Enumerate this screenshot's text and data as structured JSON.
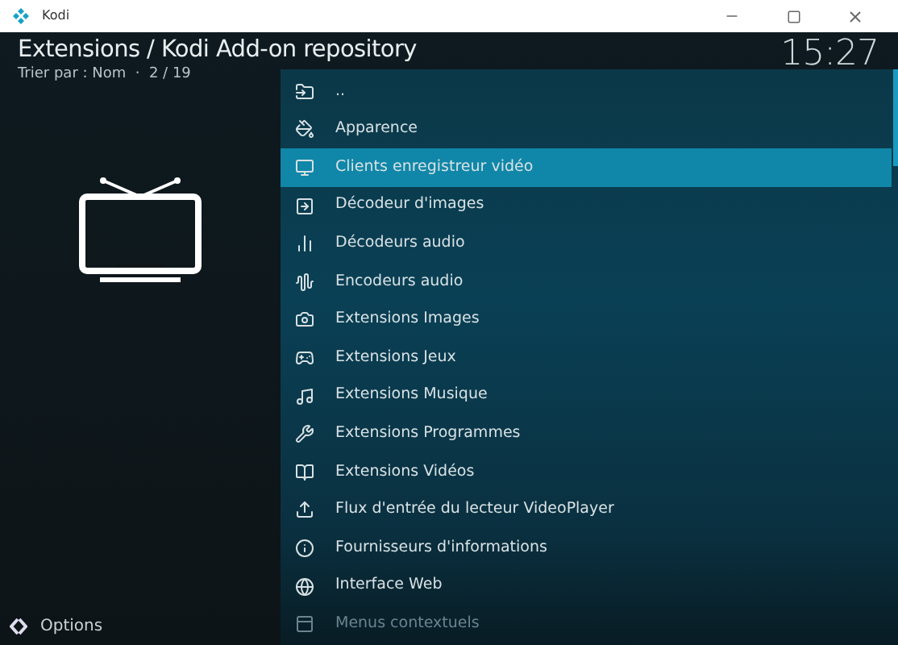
{
  "window": {
    "title": "Kodi"
  },
  "header": {
    "breadcrumb": "Extensions / Kodi Add-on repository",
    "sort_info": "Trier par : Nom  ·  2 / 19",
    "clock": "15:27"
  },
  "items": [
    {
      "label": "..",
      "selected": false,
      "dimmed": false
    },
    {
      "label": "Apparence",
      "selected": false,
      "dimmed": false
    },
    {
      "label": "Clients enregistreur vidéo",
      "selected": true,
      "dimmed": false
    },
    {
      "label": "Décodeur d'images",
      "selected": false,
      "dimmed": false
    },
    {
      "label": "Décodeurs audio",
      "selected": false,
      "dimmed": false
    },
    {
      "label": "Encodeurs audio",
      "selected": false,
      "dimmed": false
    },
    {
      "label": "Extensions Images",
      "selected": false,
      "dimmed": false
    },
    {
      "label": "Extensions Jeux",
      "selected": false,
      "dimmed": false
    },
    {
      "label": "Extensions Musique",
      "selected": false,
      "dimmed": false
    },
    {
      "label": "Extensions Programmes",
      "selected": false,
      "dimmed": false
    },
    {
      "label": "Extensions Vidéos",
      "selected": false,
      "dimmed": false
    },
    {
      "label": "Flux d'entrée du lecteur VideoPlayer",
      "selected": false,
      "dimmed": false
    },
    {
      "label": "Fournisseurs d'informations",
      "selected": false,
      "dimmed": false
    },
    {
      "label": "Interface Web",
      "selected": false,
      "dimmed": false
    },
    {
      "label": "Menus contextuels",
      "selected": false,
      "dimmed": true
    }
  ],
  "options_button": "Options"
}
